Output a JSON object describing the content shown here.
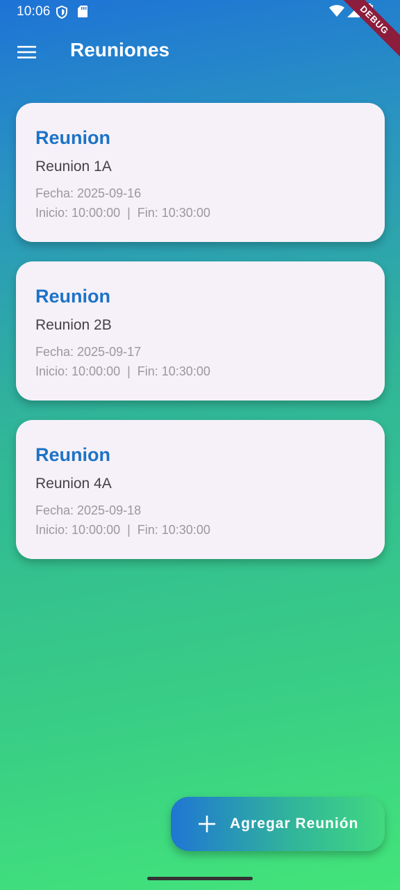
{
  "status_bar": {
    "time": "10:06",
    "icons": [
      "shield-icon",
      "sd-card-icon",
      "wifi-icon",
      "signal-icon",
      "battery-icon"
    ]
  },
  "debug_banner": {
    "label": "DEBUG"
  },
  "app_bar": {
    "menu_icon": "menu-icon",
    "title": "Reuniones"
  },
  "meetings": [
    {
      "type": "Reunion",
      "name": "Reunion 1A",
      "date": "Fecha: 2025-09-16",
      "times": "Inicio: 10:00:00  |  Fin: 10:30:00"
    },
    {
      "type": "Reunion",
      "name": "Reunion 2B",
      "date": "Fecha: 2025-09-17",
      "times": "Inicio: 10:00:00  |  Fin: 10:30:00"
    },
    {
      "type": "Reunion",
      "name": "Reunion 4A",
      "date": "Fecha: 2025-09-18",
      "times": "Inicio: 10:00:00  |  Fin: 10:30:00"
    }
  ],
  "fab": {
    "icon": "plus-icon",
    "label": "Agregar Reunión"
  },
  "colors": {
    "gradient_top": "#1e73d6",
    "gradient_bottom": "#43e47a",
    "card_background": "#f6f1f8",
    "card_title": "#1c73c7",
    "debug_banner": "#8c1d3d"
  }
}
